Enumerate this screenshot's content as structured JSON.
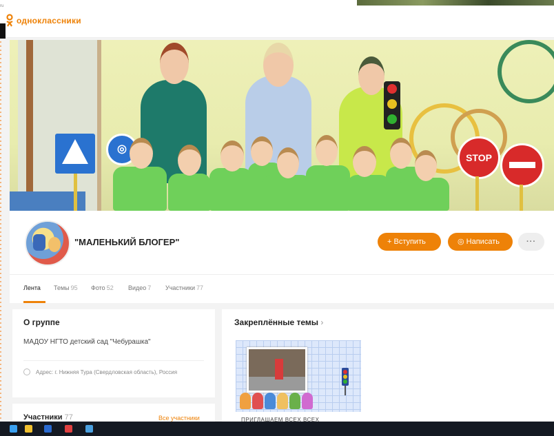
{
  "brand": {
    "name": "одноклассники",
    "accent": "#ee8208",
    "logo_icon": "ok-logo-icon"
  },
  "corner_label": "ru",
  "group": {
    "title": "\"МАЛЕНЬКИЙ БЛОГЕР\"",
    "join_label": "+ Вступить",
    "write_label": "◎ Написать",
    "more_label": "···"
  },
  "tabs": [
    {
      "label": "Лента",
      "count": ""
    },
    {
      "label": "Темы",
      "count": "95"
    },
    {
      "label": "Фото",
      "count": "52"
    },
    {
      "label": "Видео",
      "count": "7"
    },
    {
      "label": "Участники",
      "count": "77"
    }
  ],
  "about": {
    "title": "О группе",
    "description": "МАДОУ НГТО детский сад \"Чебурашка\"",
    "address": "Адрес: г. Нижняя Тура (Свердловская область), Россия",
    "address_icon": "location-pin-icon"
  },
  "members": {
    "title": "Участники",
    "count": "77",
    "link": "Все участники"
  },
  "pinned": {
    "title": "Закреплённые темы",
    "chevron": "›",
    "topic_caption": "ПРИГЛАШАЕМ ВСЕХ ВСЕХ"
  },
  "cover_signs": {
    "stop": "STOP"
  },
  "taskbar": {
    "icons": [
      "start-icon",
      "file-explorer-icon",
      "store-icon",
      "mail-icon",
      "windows-icon"
    ]
  }
}
